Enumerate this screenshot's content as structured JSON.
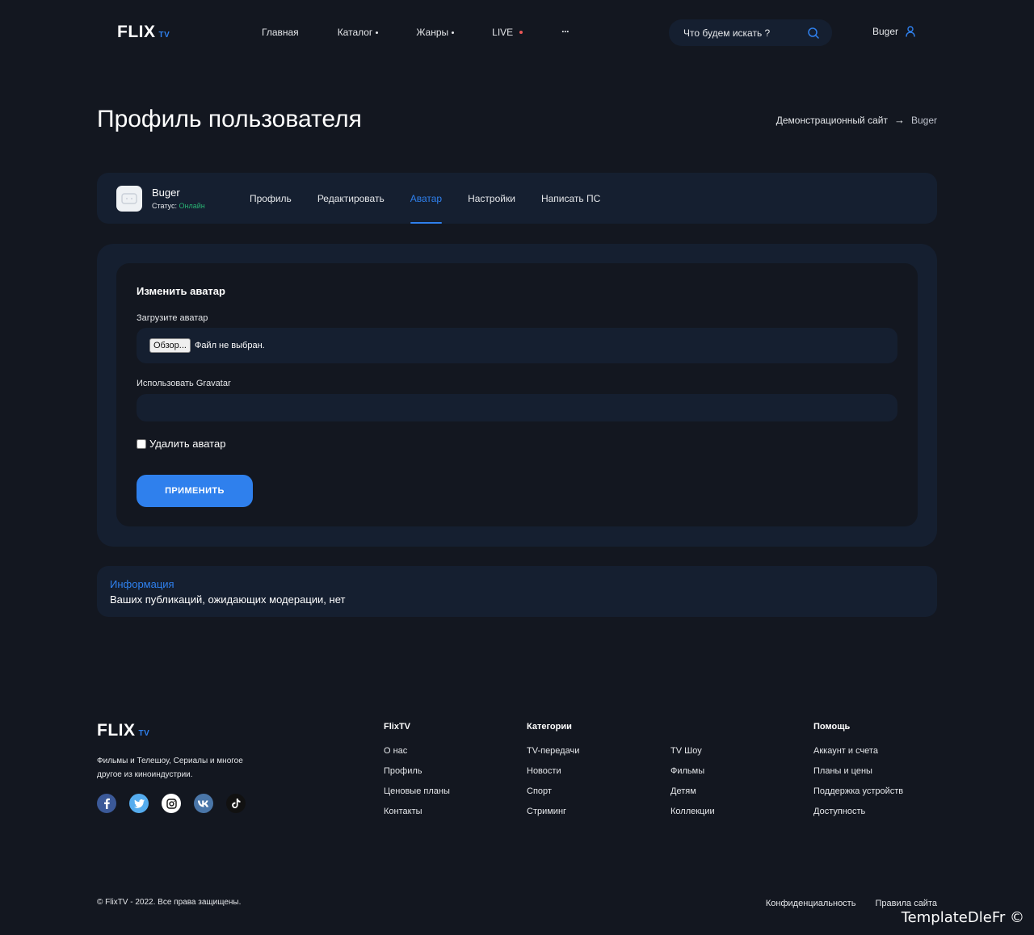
{
  "header": {
    "logo": "FLIX",
    "logo_suffix": "TV",
    "nav": [
      {
        "label": "Главная"
      },
      {
        "label": "Каталог"
      },
      {
        "label": "Жанры"
      },
      {
        "label": "LIVE"
      }
    ],
    "more_label": "···",
    "search_placeholder": "Что будем искать ?",
    "user_name": "Buger"
  },
  "page": {
    "title": "Профиль пользователя",
    "breadcrumb": {
      "home": "Демонстрационный сайт",
      "arrow": "→",
      "current": "Buger"
    }
  },
  "profile": {
    "name": "Buger",
    "status_label": "Статус:",
    "status_value": "Онлайн",
    "tabs": [
      "Профиль",
      "Редактировать",
      "Аватар",
      "Настройки",
      "Написать ПС"
    ],
    "active_tab": "Аватар"
  },
  "avatar_form": {
    "title": "Изменить аватар",
    "upload_label": "Загрузите аватар",
    "browse_button": "Обзор...",
    "no_file_text": "Файл не выбран.",
    "gravatar_label": "Использовать Gravatar",
    "delete_label": "Удалить аватар",
    "apply_button": "ПРИМЕНИТЬ"
  },
  "info": {
    "title": "Информация",
    "text": "Ваших публикаций, ожидающих модерации, нет"
  },
  "footer": {
    "logo": "FLIX",
    "logo_suffix": "TV",
    "description": "Фильмы и Телешоу, Сериалы и многое другое из киноиндустрии.",
    "socials": [
      "facebook-icon",
      "twitter-icon",
      "instagram-icon",
      "vk-icon",
      "tiktok-icon"
    ],
    "columns": [
      {
        "title": "FlixTV",
        "links": [
          "О нас",
          "Профиль",
          "Ценовые планы",
          "Контакты"
        ]
      },
      {
        "title": "Категории",
        "links": [
          "TV-передачи",
          "Новости",
          "Спорт",
          "Стриминг"
        ]
      },
      {
        "title": "",
        "links": [
          "TV Шоу",
          "Фильмы",
          "Детям",
          "Коллекции"
        ]
      },
      {
        "title": "Помощь",
        "links": [
          "Аккаунт и счета",
          "Планы и цены",
          "Поддержка устройств",
          "Доступность"
        ]
      }
    ],
    "copyright": "© FlixTV - 2022. Все права защищены.",
    "bottom_links": [
      "Конфиденциальность",
      "Правила сайта"
    ]
  },
  "watermark": "TemplateDleFr ©",
  "colors": {
    "background": "#131720",
    "card": "#151f30",
    "accent": "#2f80ed",
    "online": "#29b474",
    "live": "#eb5757"
  }
}
